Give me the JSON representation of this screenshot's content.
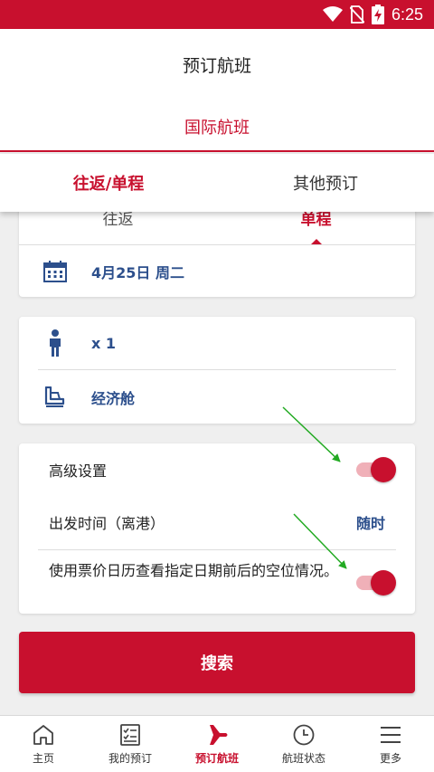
{
  "status_bar": {
    "time": "6:25"
  },
  "header": {
    "title": "预订航班",
    "subtab": "国际航班"
  },
  "tabs": [
    {
      "label": "往返/单程",
      "active": true
    },
    {
      "label": "其他预订",
      "active": false
    }
  ],
  "trip": {
    "options": [
      "往返",
      "单程"
    ],
    "selected": "单程",
    "date": "4月25日 周二"
  },
  "passengers": {
    "count": "x 1",
    "cabin": "经济舱"
  },
  "settings": {
    "advanced_label": "高级设置",
    "advanced_on": true,
    "departure_label": "出发时间（离港）",
    "departure_value": "随时",
    "calendar_label": "使用票价日历查看指定日期前后的空位情况。",
    "calendar_on": true
  },
  "search_label": "搜索",
  "nav": [
    {
      "label": "主页",
      "icon": "home-icon"
    },
    {
      "label": "我的预订",
      "icon": "bookings-icon"
    },
    {
      "label": "预订航班",
      "icon": "plane-icon",
      "active": true
    },
    {
      "label": "航班状态",
      "icon": "clock-icon"
    },
    {
      "label": "更多",
      "icon": "menu-icon"
    }
  ],
  "colors": {
    "brand": "#c8102e",
    "link": "#2c4f8c",
    "annotation": "#22aa22"
  }
}
